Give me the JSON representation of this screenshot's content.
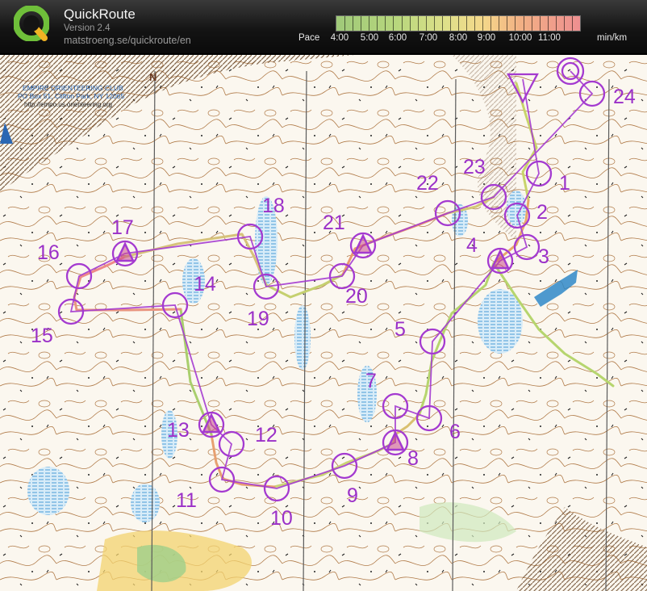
{
  "app": {
    "title": "QuickRoute",
    "version": "Version 2.4",
    "url": "matstroeng.se/quickroute/en"
  },
  "pace": {
    "label": "Pace",
    "ticks": [
      "4:00",
      "5:00",
      "6:00",
      "7:00",
      "8:00",
      "9:00",
      "10:00",
      "11:00"
    ],
    "unit": "min/km"
  },
  "map": {
    "club_name": "EMPIRE ORIENTEERING CLUB",
    "club_address": "PO Box 51, Clifton Park, NY 12065",
    "club_url": "http://empo.us.orienteering.org",
    "north_letter": "N",
    "course_color": "#a43ad0",
    "controls": [
      {
        "label": "1"
      },
      {
        "label": "2"
      },
      {
        "label": "3"
      },
      {
        "label": "4"
      },
      {
        "label": "5"
      },
      {
        "label": "6"
      },
      {
        "label": "7"
      },
      {
        "label": "8"
      },
      {
        "label": "9"
      },
      {
        "label": "10"
      },
      {
        "label": "11"
      },
      {
        "label": "12"
      },
      {
        "label": "13"
      },
      {
        "label": "14"
      },
      {
        "label": "15"
      },
      {
        "label": "16"
      },
      {
        "label": "17"
      },
      {
        "label": "18"
      },
      {
        "label": "19"
      },
      {
        "label": "20"
      },
      {
        "label": "21"
      },
      {
        "label": "22"
      },
      {
        "label": "23"
      },
      {
        "label": "24"
      }
    ]
  }
}
